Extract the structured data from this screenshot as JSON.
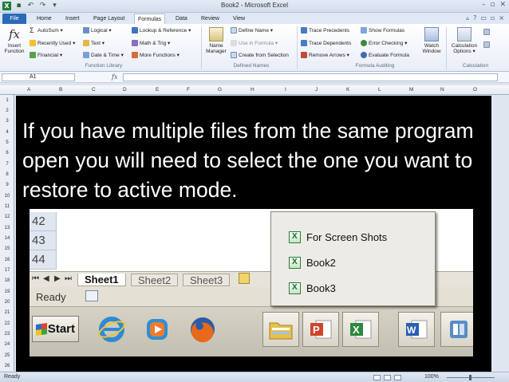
{
  "window": {
    "title": "Book2 - Microsoft Excel",
    "controls": [
      "–",
      "▫",
      "✕"
    ]
  },
  "quick_access": [
    "save-icon",
    "undo-icon",
    "redo-icon",
    "customize-icon"
  ],
  "tabs": [
    {
      "label": "File"
    },
    {
      "label": "Home"
    },
    {
      "label": "Insert"
    },
    {
      "label": "Page Layout"
    },
    {
      "label": "Formulas",
      "active": true
    },
    {
      "label": "Data"
    },
    {
      "label": "Review"
    },
    {
      "label": "View"
    }
  ],
  "ribbon": {
    "insert_function": {
      "line1": "Insert",
      "line2": "Function"
    },
    "function_library": {
      "items": [
        "AutoSum ▾",
        "Recently Used ▾",
        "Financial ▾",
        "Logical ▾",
        "Text ▾",
        "Date & Time ▾",
        "Lookup & Reference ▾",
        "Math & Trig ▾",
        "More Functions ▾"
      ],
      "label": "Function Library"
    },
    "defined_names": {
      "name_manager": {
        "line1": "Name",
        "line2": "Manager"
      },
      "items": [
        "Define Name ▾",
        "Use in Formula ▾",
        "Create from Selection"
      ],
      "label": "Defined Names"
    },
    "formula_auditing": {
      "items": [
        "Trace Precedents",
        "Trace Dependents",
        "Remove Arrows ▾",
        "Show Formulas",
        "Error Checking ▾",
        "Evaluate Formula"
      ],
      "watch_window": {
        "line1": "Watch",
        "line2": "Window"
      },
      "label": "Formula Auditing"
    },
    "calculation": {
      "options": {
        "line1": "Calculation",
        "line2": "Options ▾"
      },
      "label": "Calculation"
    }
  },
  "formula_bar": {
    "name_box": "A1",
    "fx": "fx",
    "value": ""
  },
  "columns": [
    "A",
    "B",
    "C",
    "D",
    "E",
    "F",
    "G",
    "H",
    "I",
    "J",
    "K",
    "L",
    "M",
    "N",
    "O"
  ],
  "rows": [
    "1",
    "2",
    "3",
    "4",
    "5",
    "6",
    "7",
    "8",
    "9",
    "10",
    "11",
    "12",
    "13",
    "14",
    "15",
    "16",
    "17",
    "18",
    "19",
    "20",
    "21",
    "22",
    "23",
    "24",
    "25",
    "26"
  ],
  "overlay": {
    "text": "If you have multiple files from the same program open you will need to select the one you want to restore to active mode."
  },
  "inner": {
    "row_numbers": [
      "42",
      "43",
      "44"
    ],
    "sheet_tabs": [
      "Sheet1",
      "Sheet2",
      "Sheet3"
    ],
    "status": "Ready",
    "start_label": "Start",
    "taskbar_icons": [
      "internet-explorer-icon",
      "media-player-icon",
      "firefox-icon",
      "folder-icon",
      "powerpoint-icon",
      "excel-icon",
      "word-icon",
      "windows-live-icon"
    ],
    "popup_items": [
      "For Screen Shots",
      "Book2",
      "Book3"
    ]
  },
  "statusbar": {
    "status": "Ready",
    "zoom": "100%"
  },
  "colors": {
    "file_tab": "#2a6ab8",
    "overlay_bg": "#000000",
    "overlay_text": "#ffffff",
    "excel_green": "#1f7a3a"
  }
}
